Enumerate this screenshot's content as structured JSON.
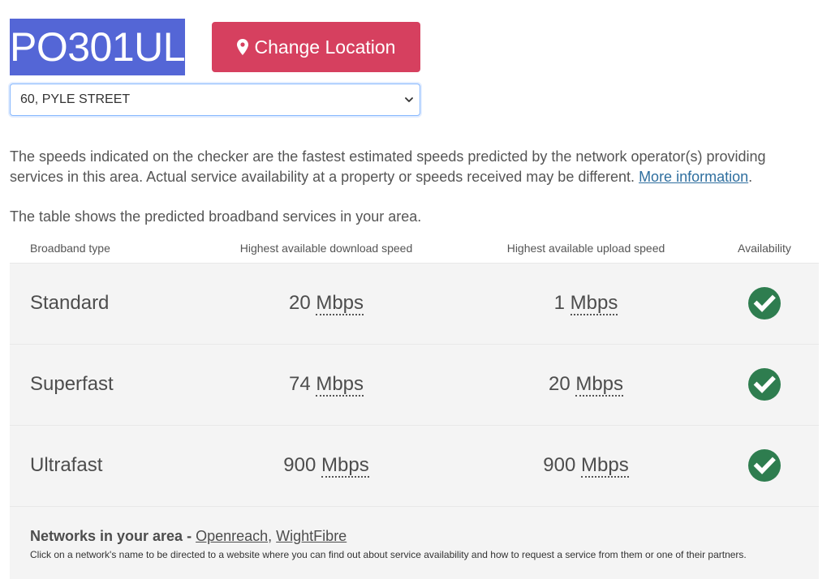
{
  "header": {
    "postcode": "PO301UL",
    "change_location_label": "Change Location"
  },
  "address_select": {
    "selected": "60, PYLE STREET"
  },
  "info": {
    "text": "The speeds indicated on the checker are the fastest estimated speeds predicted by the network operator(s) providing services in this area. Actual service availability at a property or speeds received may be different.",
    "link": "More information",
    "trailing": "."
  },
  "table_intro": "The table shows the predicted broadband services in your area.",
  "table": {
    "headers": {
      "type": "Broadband type",
      "download": "Highest available download speed",
      "upload": "Highest available upload speed",
      "availability": "Availability"
    },
    "rows": [
      {
        "type": "Standard",
        "download_value": "20",
        "download_unit": "Mbps",
        "upload_value": "1",
        "upload_unit": "Mbps",
        "available": true
      },
      {
        "type": "Superfast",
        "download_value": "74",
        "download_unit": "Mbps",
        "upload_value": "20",
        "upload_unit": "Mbps",
        "available": true
      },
      {
        "type": "Ultrafast",
        "download_value": "900",
        "download_unit": "Mbps",
        "upload_value": "900",
        "upload_unit": "Mbps",
        "available": true
      }
    ]
  },
  "networks": {
    "title": "Networks in your area -",
    "links": [
      "Openreach",
      "WightFibre"
    ],
    "separator": ", ",
    "note": "Click on a network's name to be directed to a website where you can find out about service availability and how to request a service from them or one of their partners."
  },
  "colors": {
    "postcode_bg": "#5466d6",
    "button_bg": "#d6405f",
    "check_green": "#2e7d4f",
    "row_bg": "#f4f4f4",
    "link_blue": "#2f6f9f"
  },
  "icons": {
    "button": "map-marker-icon",
    "availability": "check-circle-icon",
    "select": "chevron-down-icon"
  }
}
